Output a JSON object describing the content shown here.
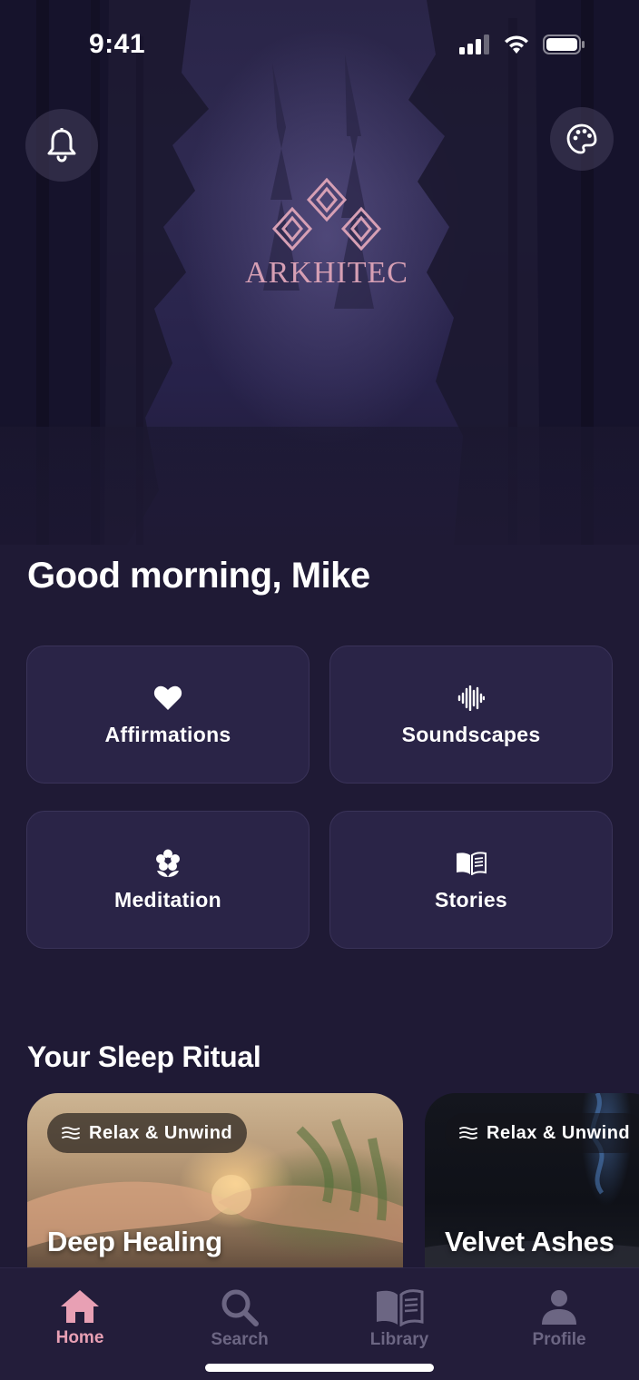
{
  "status_bar": {
    "time": "9:41"
  },
  "header": {
    "logo_text": "ARKHITEC",
    "bell_icon": "bell-icon",
    "palette_icon": "palette-icon"
  },
  "greeting": "Good morning, Mike",
  "categories": [
    {
      "label": "Affirmations",
      "icon": "heart-icon"
    },
    {
      "label": "Soundscapes",
      "icon": "waveform-icon"
    },
    {
      "label": "Meditation",
      "icon": "flower-icon"
    },
    {
      "label": "Stories",
      "icon": "book-icon"
    }
  ],
  "sleep_ritual": {
    "title": "Your Sleep Ritual",
    "cards": [
      {
        "tag": "Relax & Unwind",
        "title": "Deep Healing"
      },
      {
        "tag": "Relax & Unwind",
        "title": "Velvet Ashes"
      }
    ]
  },
  "tabbar": {
    "tabs": [
      {
        "label": "Home",
        "icon": "home-icon",
        "active": true
      },
      {
        "label": "Search",
        "icon": "search-icon",
        "active": false
      },
      {
        "label": "Library",
        "icon": "library-icon",
        "active": false
      },
      {
        "label": "Profile",
        "icon": "profile-icon",
        "active": false
      }
    ]
  },
  "colors": {
    "background": "#1f1a35",
    "tile": "#2a2447",
    "accent_pink": "#e8a0b4",
    "logo": "#d69fb4",
    "inactive": "#6c6683"
  }
}
